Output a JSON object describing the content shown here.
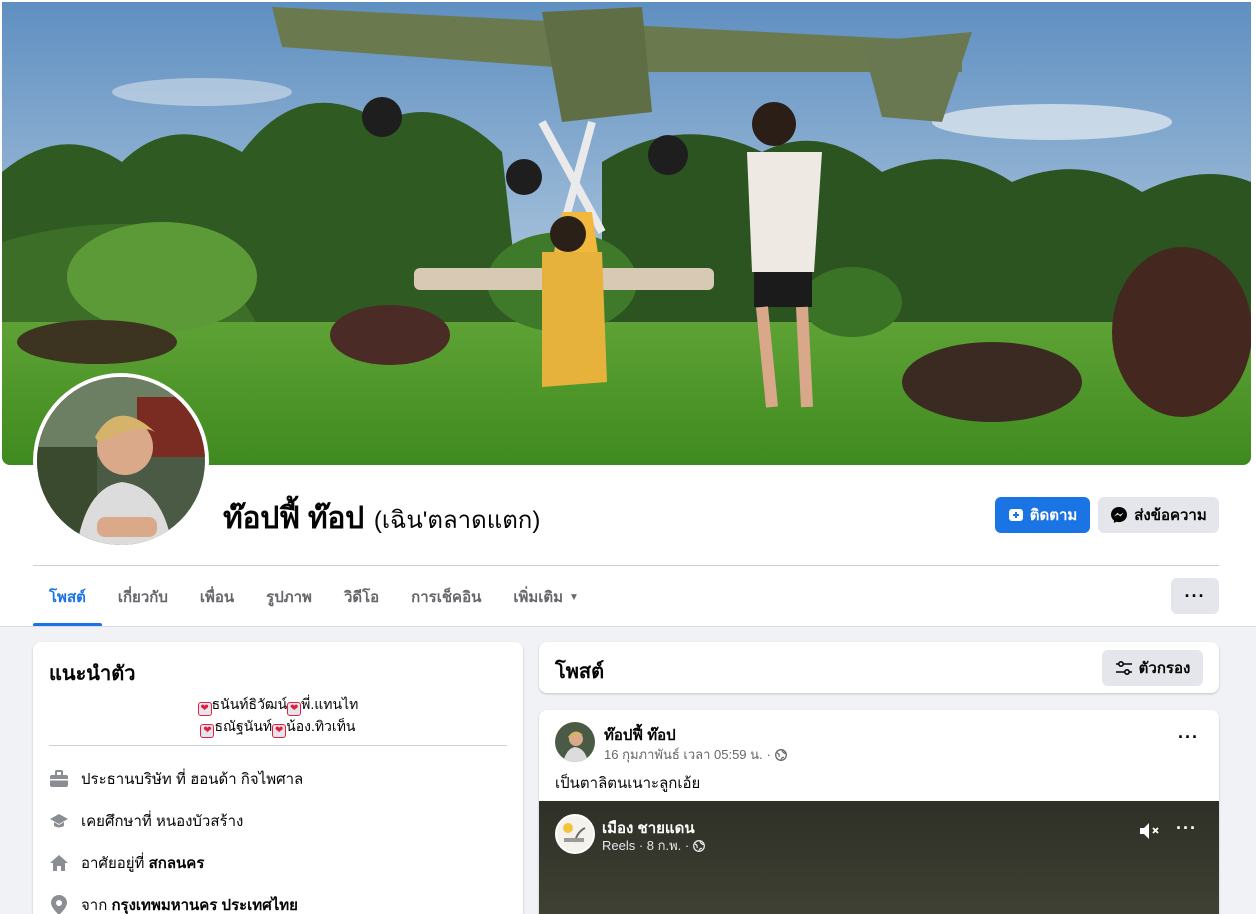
{
  "profile": {
    "name": "ท๊อปฟี้ ท๊อป",
    "alternate_name": "(เฉิน'ตลาดแตก)",
    "follow_label": "ติดตาม",
    "message_label": "ส่งข้อความ"
  },
  "tabs": [
    {
      "label": "โพสต์",
      "active": true
    },
    {
      "label": "เกี่ยวกับ",
      "active": false
    },
    {
      "label": "เพื่อน",
      "active": false
    },
    {
      "label": "รูปภาพ",
      "active": false
    },
    {
      "label": "วิดีโอ",
      "active": false
    },
    {
      "label": "การเช็คอิน",
      "active": false
    },
    {
      "label": "เพิ่มเติม",
      "active": false
    }
  ],
  "intro": {
    "title": "แนะนำตัว",
    "bio_line1": "ธนันท์ธิวัฒน์",
    "bio_line1_b": "พี่.แทนไท",
    "bio_line2": "ธณัฐนันท์",
    "bio_line2_b": "น้อง.ทิวเท็น",
    "work_prefix": "ประธานบริษัท ที่",
    "work_place": "ฮอนด้า กิจไพศาล",
    "edu_prefix": "เคยศึกษาที่",
    "edu_place": "หนองบัวสร้าง",
    "live_prefix": "อาศัยอยู่ที่",
    "live_place": "สกลนคร",
    "from_prefix": "จาก",
    "from_place": "กรุงเทพมหานคร ประเทศไทย"
  },
  "posts_header": {
    "title": "โพสต์",
    "filter_label": "ตัวกรอง"
  },
  "post": {
    "author": "ท๊อปฟี้ ท๊อป",
    "timestamp": "16 กุมภาพันธ์ เวลา 05:59 น.",
    "text": "เป็นตาลิตนเนาะลูกเอ้ย",
    "reel_author": "เมือง ชายแดน",
    "reel_meta": "Reels · 8 ก.พ. ·"
  },
  "colors": {
    "primary": "#1b74e4",
    "heart_border": "#e41e3f"
  }
}
